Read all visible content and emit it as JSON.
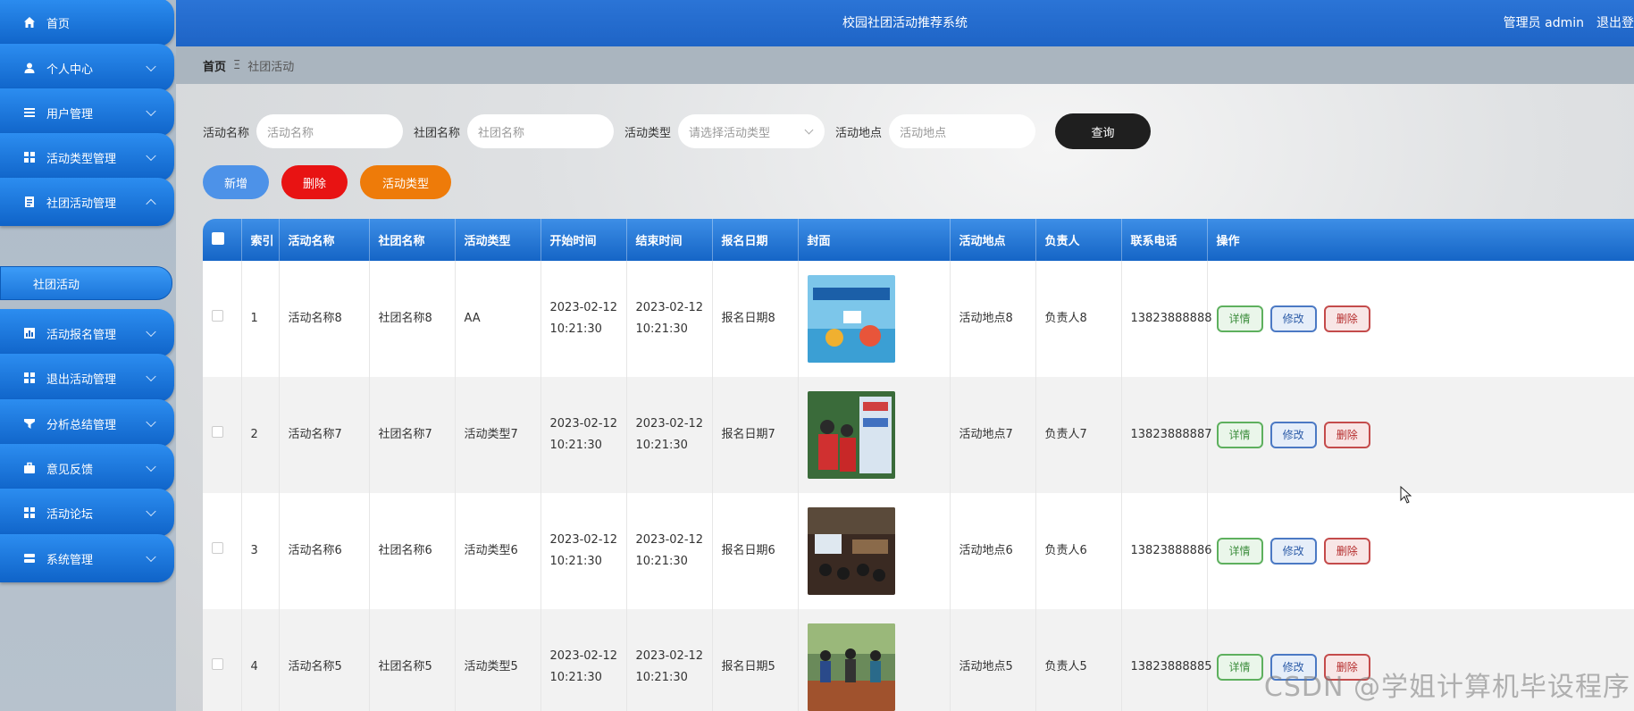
{
  "sidebar": {
    "items": [
      {
        "label": "首页",
        "icon": "home-icon"
      },
      {
        "label": "个人中心",
        "icon": "user-icon"
      },
      {
        "label": "用户管理",
        "icon": "list-icon"
      },
      {
        "label": "活动类型管理",
        "icon": "grid-icon"
      },
      {
        "label": "社团活动管理",
        "icon": "document-icon"
      },
      {
        "label": "活动报名管理",
        "icon": "chart-icon"
      },
      {
        "label": "退出活动管理",
        "icon": "grid-icon"
      },
      {
        "label": "分析总结管理",
        "icon": "filter-icon"
      },
      {
        "label": "意见反馈",
        "icon": "briefcase-icon"
      },
      {
        "label": "活动论坛",
        "icon": "grid-icon"
      },
      {
        "label": "系统管理",
        "icon": "server-icon"
      }
    ],
    "sub_item": "社团活动"
  },
  "header": {
    "title": "校园社团活动推荐系统",
    "admin": "管理员 admin",
    "logout": "退出登录"
  },
  "breadcrumb": {
    "home": "首页",
    "separator": "Ξ",
    "current": "社团活动"
  },
  "search": {
    "name_label": "活动名称",
    "name_placeholder": "活动名称",
    "club_label": "社团名称",
    "club_placeholder": "社团名称",
    "type_label": "活动类型",
    "type_placeholder": "请选择活动类型",
    "place_label": "活动地点",
    "place_placeholder": "活动地点",
    "query_label": "查询"
  },
  "actions": {
    "add": "新增",
    "delete": "删除",
    "type": "活动类型"
  },
  "table": {
    "headers": [
      "索引",
      "活动名称",
      "社团名称",
      "活动类型",
      "开始时间",
      "结束时间",
      "报名日期",
      "封面",
      "活动地点",
      "负责人",
      "联系电话",
      "操作"
    ],
    "rows": [
      {
        "index": "1",
        "name": "活动名称8",
        "club": "社团名称8",
        "type": "AA",
        "start": "2023-02-12 10:21:30",
        "end": "2023-02-12 10:21:30",
        "signup": "报名日期8",
        "place": "活动地点8",
        "leader": "负责人8",
        "phone": "13823888888"
      },
      {
        "index": "2",
        "name": "活动名称7",
        "club": "社团名称7",
        "type": "活动类型7",
        "start": "2023-02-12 10:21:30",
        "end": "2023-02-12 10:21:30",
        "signup": "报名日期7",
        "place": "活动地点7",
        "leader": "负责人7",
        "phone": "13823888887"
      },
      {
        "index": "3",
        "name": "活动名称6",
        "club": "社团名称6",
        "type": "活动类型6",
        "start": "2023-02-12 10:21:30",
        "end": "2023-02-12 10:21:30",
        "signup": "报名日期6",
        "place": "活动地点6",
        "leader": "负责人6",
        "phone": "13823888886"
      },
      {
        "index": "4",
        "name": "活动名称5",
        "club": "社团名称5",
        "type": "活动类型5",
        "start": "2023-02-12 10:21:30",
        "end": "2023-02-12 10:21:30",
        "signup": "报名日期5",
        "place": "活动地点5",
        "leader": "负责人5",
        "phone": "13823888885"
      }
    ],
    "op_detail": "详情",
    "op_edit": "修改",
    "op_delete": "删除"
  },
  "watermark": "CSDN @学姐计算机毕设程序",
  "colors": {
    "accent": "#1e64c6",
    "add": "#4d92e8",
    "delete": "#e81313",
    "type": "#ee7b09",
    "query": "#1f1f1f"
  }
}
